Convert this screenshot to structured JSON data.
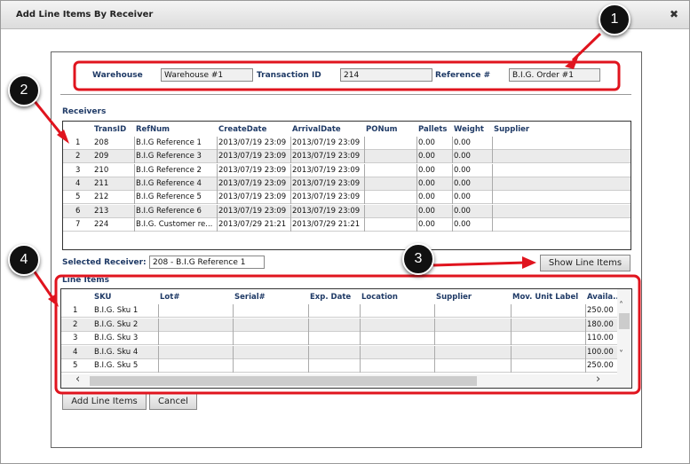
{
  "window": {
    "title": "Add Line Items By Receiver",
    "close_icon": "close-icon"
  },
  "header": {
    "warehouse_label": "Warehouse",
    "warehouse_value": "Warehouse #1",
    "transaction_label": "Transaction ID",
    "transaction_value": "214",
    "reference_label": "Reference #",
    "reference_value": "B.I.G. Order #1"
  },
  "receivers": {
    "label": "Receivers",
    "columns": [
      "",
      "TransID",
      "RefNum",
      "CreateDate",
      "ArrivalDate",
      "PONum",
      "Pallets",
      "Weight",
      "Supplier"
    ],
    "rows": [
      [
        "1",
        "208",
        "B.I.G Reference 1",
        "2013/07/19 23:09",
        "2013/07/19 23:09",
        "",
        "0.00",
        "0.00",
        ""
      ],
      [
        "2",
        "209",
        "B.I.G Reference 3",
        "2013/07/19 23:09",
        "2013/07/19 23:09",
        "",
        "0.00",
        "0.00",
        ""
      ],
      [
        "3",
        "210",
        "B.I.G Reference 2",
        "2013/07/19 23:09",
        "2013/07/19 23:09",
        "",
        "0.00",
        "0.00",
        ""
      ],
      [
        "4",
        "211",
        "B.I.G Reference 4",
        "2013/07/19 23:09",
        "2013/07/19 23:09",
        "",
        "0.00",
        "0.00",
        ""
      ],
      [
        "5",
        "212",
        "B.I.G Reference 5",
        "2013/07/19 23:09",
        "2013/07/19 23:09",
        "",
        "0.00",
        "0.00",
        ""
      ],
      [
        "6",
        "213",
        "B.I.G Reference 6",
        "2013/07/19 23:09",
        "2013/07/19 23:09",
        "",
        "0.00",
        "0.00",
        ""
      ],
      [
        "7",
        "224",
        "B.I.G. Customer re...",
        "2013/07/29 21:21",
        "2013/07/29 21:21",
        "",
        "0.00",
        "0.00",
        ""
      ]
    ]
  },
  "selected": {
    "label": "Selected Receiver:",
    "value": "208 - B.I.G Reference 1"
  },
  "show_line_items": "Show Line Items",
  "line_items": {
    "label": "Line Items",
    "columns": [
      "",
      "SKU",
      "Lot#",
      "Serial#",
      "Exp. Date",
      "Location",
      "Supplier",
      "Mov. Unit Label",
      "Availa..."
    ],
    "rows": [
      [
        "1",
        "B.I.G. Sku 1",
        "",
        "",
        "",
        "",
        "",
        "",
        "250.00"
      ],
      [
        "2",
        "B.I.G. Sku 2",
        "",
        "",
        "",
        "",
        "",
        "",
        "180.00"
      ],
      [
        "3",
        "B.I.G. Sku 3",
        "",
        "",
        "",
        "",
        "",
        "",
        "110.00"
      ],
      [
        "4",
        "B.I.G. Sku 4",
        "",
        "",
        "",
        "",
        "",
        "",
        "100.00"
      ],
      [
        "5",
        "B.I.G. Sku 5",
        "",
        "",
        "",
        "",
        "",
        "",
        "250.00"
      ]
    ]
  },
  "buttons": {
    "add": "Add Line Items",
    "cancel": "Cancel"
  },
  "annotations": [
    "1",
    "2",
    "3",
    "4"
  ],
  "colors": {
    "annotation": "#e0141e",
    "label": "#1f3a66"
  }
}
